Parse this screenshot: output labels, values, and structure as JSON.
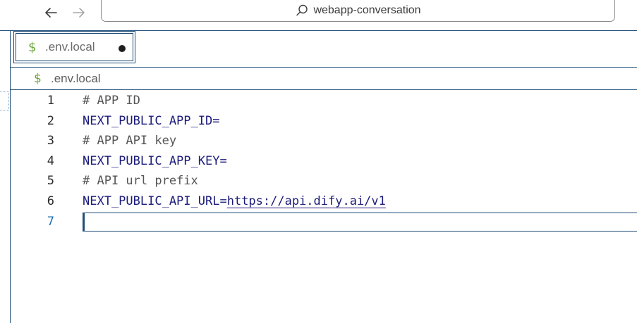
{
  "titlebar": {
    "search_text": "webapp-conversation",
    "icons": {
      "back": "arrow-left-icon",
      "forward": "arrow-right-icon",
      "search": "search-icon"
    }
  },
  "tabs": [
    {
      "label": ".env.local",
      "icon": "dollar-icon",
      "modified": true,
      "active": true
    }
  ],
  "breadcrumb": {
    "label": ".env.local",
    "icon": "dollar-icon"
  },
  "editor": {
    "current_line": 7,
    "lines": [
      {
        "number": "1",
        "text": "# APP ID"
      },
      {
        "number": "2",
        "key": "NEXT_PUBLIC_APP_ID",
        "op": "=",
        "value": ""
      },
      {
        "number": "3",
        "text": "# APP API key"
      },
      {
        "number": "4",
        "key": "NEXT_PUBLIC_APP_KEY",
        "op": "=",
        "value": ""
      },
      {
        "number": "5",
        "text": "# API url prefix"
      },
      {
        "number": "6",
        "key": "NEXT_PUBLIC_API_URL",
        "op": "=",
        "value": "https://api.dify.ai/v1"
      },
      {
        "number": "7",
        "text": ""
      }
    ]
  },
  "colors": {
    "accent": "#1f4e79",
    "dollar_icon": "#6ba73b",
    "key": "#1b1b7a",
    "comment": "#555555",
    "active_line_number": "#1f6fb2"
  }
}
